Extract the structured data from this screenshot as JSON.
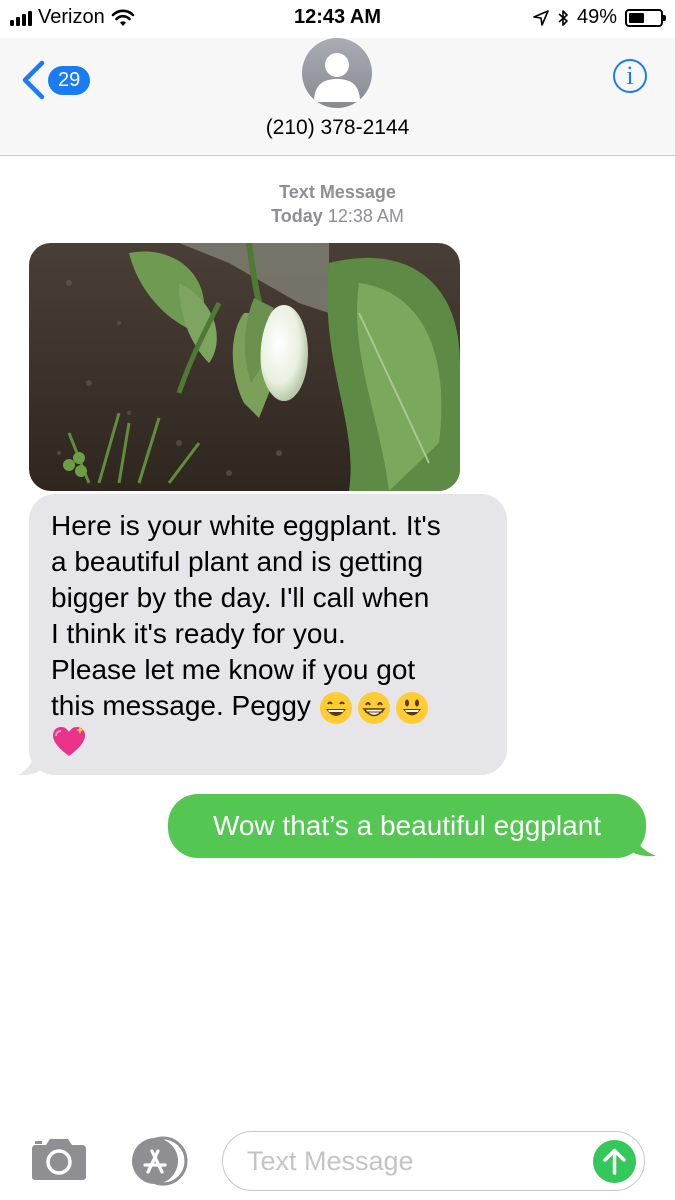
{
  "status_bar": {
    "carrier": "Verizon",
    "time": "12:43 AM",
    "battery_percent": "49%",
    "battery_level": 0.49
  },
  "header": {
    "back_count": "29",
    "contact": "(210) 378-2144",
    "icons": {
      "back": "chevron-left-icon",
      "info": "info-icon",
      "avatar": "person-silhouette-icon"
    }
  },
  "thread": {
    "service_label": "Text Message",
    "day_label": "Today",
    "time_label": "12:38 AM",
    "messages": [
      {
        "direction": "incoming",
        "kind": "image",
        "description_icon": "photo-attachment"
      },
      {
        "direction": "incoming",
        "kind": "text",
        "lines": [
          "Here is your white eggplant. It's",
          "a beautiful plant and is getting",
          "bigger by the day. I'll call when",
          "I think it's ready for you.",
          "Please let me know if you got",
          "this message. Peggy"
        ],
        "emojis": [
          "😄",
          "😁",
          "😃",
          "💖"
        ]
      },
      {
        "direction": "outgoing",
        "kind": "text",
        "text": "Wow that’s a beautiful eggplant"
      }
    ]
  },
  "composer": {
    "placeholder": "Text Message",
    "icons": {
      "camera": "camera-icon",
      "apps": "app-store-icon",
      "send": "send-arrow-icon"
    }
  },
  "colors": {
    "ios_blue": "#1a7cf5",
    "incoming_bubble": "#e5e5ea",
    "outgoing_bubble": "#54c753",
    "secondary_text": "#8e8e93"
  }
}
